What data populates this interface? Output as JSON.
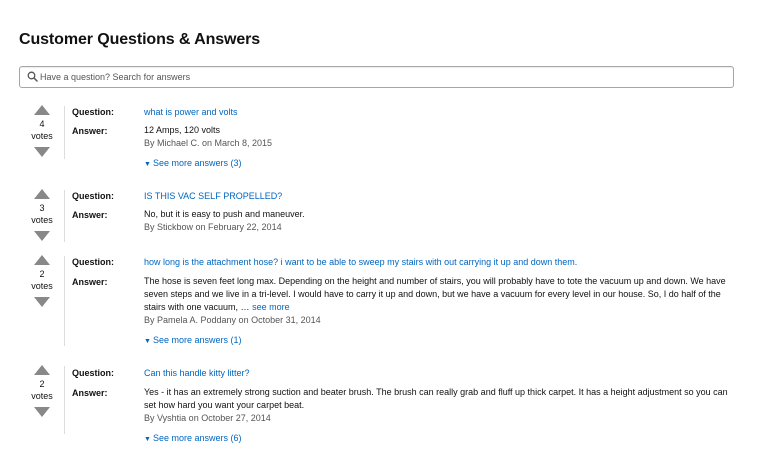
{
  "page": {
    "title": "Customer Questions & Answers",
    "search_placeholder": "Have a question? Search for answers"
  },
  "labels": {
    "question": "Question:",
    "answer": "Answer:",
    "votes": "votes"
  },
  "colors": {
    "link": "#0066c0",
    "vote_arrow": "#888888",
    "divider": "#dddddd"
  },
  "icons": {
    "search": "search-icon",
    "upvote": "upvote-arrow-icon",
    "downvote": "downvote-arrow-icon",
    "see_more": "chevron-down-icon"
  },
  "items": [
    {
      "votes": "4",
      "question": "what is power and volts",
      "answer": "12 Amps, 120 volts",
      "answer_more": "",
      "byline": "By Michael C. on March 8, 2015",
      "see_more": "See more answers (3)"
    },
    {
      "votes": "3",
      "question": "IS THIS VAC SELF PROPELLED?",
      "answer": "No, but it is easy to push and maneuver.",
      "answer_more": "",
      "byline": "By Stickbow on February 22, 2014",
      "see_more": ""
    },
    {
      "votes": "2",
      "question": "how long is the attachment hose? i want to be able to sweep my stairs with out carrying it up and down them.",
      "answer": "The hose is seven feet long max. Depending on the height and number of stairs, you will probably have to tote the vacuum up and down. We have seven steps and we live in a tri-level. I would have to carry it up and down, but we have a vacuum for every level in our house. So, I do half of the stairs with one vacuum, …",
      "answer_more": "see more",
      "byline": "By Pamela A. Poddany on October 31, 2014",
      "see_more": "See more answers (1)"
    },
    {
      "votes": "2",
      "question": "Can this handle kitty litter?",
      "answer": "Yes - it has an extremely strong suction and beater brush. The brush can really grab and fluff up thick carpet. It has a height adjustment so you can set how hard you want your carpet beat.",
      "answer_more": "",
      "byline": "By Vyshtia on October 27, 2014",
      "see_more": "See more answers (6)"
    }
  ]
}
